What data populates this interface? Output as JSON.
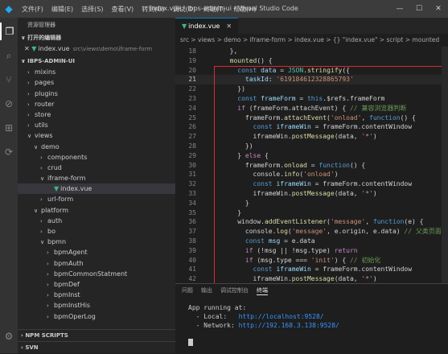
{
  "titlebar": {
    "menu": [
      "文件(F)",
      "编辑(E)",
      "选择(S)",
      "查看(V)",
      "转到(G)",
      "调试(D)",
      "终端(T)",
      "帮助(H)"
    ],
    "title": "index.vue - ibps-admin-ui - Visual Studio Code"
  },
  "sidebar": {
    "title": "资源管理器",
    "open_editors_header": "打开的编辑器",
    "open_file": {
      "name": "index.vue",
      "path": "src\\views\\demo\\iframe-form"
    },
    "project_header": "IBPS-ADMIN-UI",
    "tree": [
      {
        "label": "mixins",
        "depth": 1,
        "chevron": ">"
      },
      {
        "label": "pages",
        "depth": 1,
        "chevron": ">"
      },
      {
        "label": "plugins",
        "depth": 1,
        "chevron": ">"
      },
      {
        "label": "router",
        "depth": 1,
        "chevron": ">"
      },
      {
        "label": "store",
        "depth": 1,
        "chevron": ">"
      },
      {
        "label": "utils",
        "depth": 1,
        "chevron": ">"
      },
      {
        "label": "views",
        "depth": 1,
        "chevron": "v"
      },
      {
        "label": "demo",
        "depth": 2,
        "chevron": "v"
      },
      {
        "label": "components",
        "depth": 3,
        "chevron": ">"
      },
      {
        "label": "crud",
        "depth": 3,
        "chevron": ">"
      },
      {
        "label": "iframe-form",
        "depth": 3,
        "chevron": "v"
      },
      {
        "label": "index.vue",
        "depth": 4,
        "chevron": "",
        "vue": true,
        "selected": true
      },
      {
        "label": "url-form",
        "depth": 3,
        "chevron": ">"
      },
      {
        "label": "platform",
        "depth": 2,
        "chevron": "v"
      },
      {
        "label": "auth",
        "depth": 3,
        "chevron": ">"
      },
      {
        "label": "bo",
        "depth": 3,
        "chevron": ">"
      },
      {
        "label": "bpmn",
        "depth": 3,
        "chevron": "v"
      },
      {
        "label": "bpmAgent",
        "depth": 4,
        "chevron": ">"
      },
      {
        "label": "bpmAuth",
        "depth": 4,
        "chevron": ">"
      },
      {
        "label": "bpmCommonStatment",
        "depth": 4,
        "chevron": ">"
      },
      {
        "label": "bpmDef",
        "depth": 4,
        "chevron": ">"
      },
      {
        "label": "bpmInst",
        "depth": 4,
        "chevron": ">"
      },
      {
        "label": "bpmInstHis",
        "depth": 4,
        "chevron": ">"
      },
      {
        "label": "bpmOperLog",
        "depth": 4,
        "chevron": ">"
      }
    ],
    "npm_scripts": "NPM SCRIPTS",
    "svn": "SVN"
  },
  "editor": {
    "tab_label": "index.vue",
    "breadcrumb": "src > views > demo > iframe-form > index.vue > {} \"index.vue\" > script > mounted",
    "lines": [
      {
        "n": "18",
        "code": [
          [
            "c-plain",
            "  },"
          ]
        ]
      },
      {
        "n": "19",
        "code": [
          [
            "c-fn",
            "  mounted"
          ],
          [
            "c-plain",
            "() {"
          ]
        ]
      },
      {
        "n": "20",
        "code": [
          [
            "c-plain",
            "    "
          ],
          [
            "c-kw",
            "const "
          ],
          [
            "c-var",
            "data"
          ],
          [
            "c-plain",
            " = "
          ],
          [
            "c-cls",
            "JSON"
          ],
          [
            "c-plain",
            "."
          ],
          [
            "c-fn",
            "stringify"
          ],
          [
            "c-plain",
            "({"
          ]
        ]
      },
      {
        "n": "21",
        "code": [
          [
            "c-plain",
            "      "
          ],
          [
            "c-var",
            "taskId"
          ],
          [
            "c-plain",
            ": "
          ],
          [
            "c-str",
            "'619184612328865793'"
          ]
        ],
        "current": true
      },
      {
        "n": "22",
        "code": [
          [
            "c-plain",
            "    })"
          ]
        ]
      },
      {
        "n": "23",
        "code": [
          [
            "c-plain",
            "    "
          ],
          [
            "c-kw",
            "const "
          ],
          [
            "c-var",
            "frameForm"
          ],
          [
            "c-plain",
            " = "
          ],
          [
            "c-kw",
            "this"
          ],
          [
            "c-plain",
            ".$refs.frameForm"
          ]
        ]
      },
      {
        "n": "24",
        "code": [
          [
            "c-plain",
            "    "
          ],
          [
            "c-ctl",
            "if"
          ],
          [
            "c-plain",
            " (frameForm.attachEvent) { "
          ],
          [
            "c-cmt",
            "// 兼容浏览器判断"
          ]
        ]
      },
      {
        "n": "25",
        "code": [
          [
            "c-plain",
            "      frameForm."
          ],
          [
            "c-fn",
            "attachEvent"
          ],
          [
            "c-plain",
            "("
          ],
          [
            "c-str",
            "'onload'"
          ],
          [
            "c-plain",
            ", "
          ],
          [
            "c-kw",
            "function"
          ],
          [
            "c-plain",
            "() {"
          ]
        ]
      },
      {
        "n": "26",
        "code": [
          [
            "c-plain",
            "        "
          ],
          [
            "c-kw",
            "const "
          ],
          [
            "c-var",
            "iframeWin"
          ],
          [
            "c-plain",
            " = frameForm.contentWindow"
          ]
        ]
      },
      {
        "n": "27",
        "code": [
          [
            "c-plain",
            "        iframeWin."
          ],
          [
            "c-fn",
            "postMessage"
          ],
          [
            "c-plain",
            "(data, "
          ],
          [
            "c-str",
            "'*'"
          ],
          [
            "c-plain",
            ")"
          ]
        ]
      },
      {
        "n": "28",
        "code": [
          [
            "c-plain",
            "      })"
          ]
        ]
      },
      {
        "n": "29",
        "code": [
          [
            "c-plain",
            "    } "
          ],
          [
            "c-ctl",
            "else"
          ],
          [
            "c-plain",
            " {"
          ]
        ]
      },
      {
        "n": "30",
        "code": [
          [
            "c-plain",
            "      frameForm."
          ],
          [
            "c-fn",
            "onload"
          ],
          [
            "c-plain",
            " = "
          ],
          [
            "c-kw",
            "function"
          ],
          [
            "c-plain",
            "() {"
          ]
        ]
      },
      {
        "n": "31",
        "code": [
          [
            "c-plain",
            "        console."
          ],
          [
            "c-fn",
            "info"
          ],
          [
            "c-plain",
            "("
          ],
          [
            "c-str",
            "'onload'"
          ],
          [
            "c-plain",
            ")"
          ]
        ]
      },
      {
        "n": "32",
        "code": [
          [
            "c-plain",
            "        "
          ],
          [
            "c-kw",
            "const "
          ],
          [
            "c-var",
            "iframeWin"
          ],
          [
            "c-plain",
            " = frameForm.contentWindow"
          ]
        ]
      },
      {
        "n": "33",
        "code": [
          [
            "c-plain",
            "        iframeWin."
          ],
          [
            "c-fn",
            "postMessage"
          ],
          [
            "c-plain",
            "(data, "
          ],
          [
            "c-str",
            "'*'"
          ],
          [
            "c-plain",
            ")"
          ]
        ]
      },
      {
        "n": "34",
        "code": [
          [
            "c-plain",
            "      }"
          ]
        ]
      },
      {
        "n": "35",
        "code": [
          [
            "c-plain",
            "    }"
          ]
        ]
      },
      {
        "n": "36",
        "code": [
          [
            "c-plain",
            "    window."
          ],
          [
            "c-fn",
            "addEventListener"
          ],
          [
            "c-plain",
            "("
          ],
          [
            "c-str",
            "'message'"
          ],
          [
            "c-plain",
            ", "
          ],
          [
            "c-kw",
            "function"
          ],
          [
            "c-plain",
            "(e) {"
          ]
        ]
      },
      {
        "n": "37",
        "code": [
          [
            "c-plain",
            "      console."
          ],
          [
            "c-fn",
            "log"
          ],
          [
            "c-plain",
            "("
          ],
          [
            "c-str",
            "'message'"
          ],
          [
            "c-plain",
            ", e.origin, e.data) "
          ],
          [
            "c-cmt",
            "// 父类页面接收参数"
          ]
        ]
      },
      {
        "n": "38",
        "code": [
          [
            "c-plain",
            "      "
          ],
          [
            "c-kw",
            "const "
          ],
          [
            "c-var",
            "msg"
          ],
          [
            "c-plain",
            " = e.data"
          ]
        ]
      },
      {
        "n": "39",
        "code": [
          [
            "c-plain",
            "      "
          ],
          [
            "c-ctl",
            "if"
          ],
          [
            "c-plain",
            " (!msg || !msg.type) "
          ],
          [
            "c-ctl",
            "return"
          ]
        ]
      },
      {
        "n": "40",
        "code": [
          [
            "c-plain",
            "      "
          ],
          [
            "c-ctl",
            "if"
          ],
          [
            "c-plain",
            " (msg.type === "
          ],
          [
            "c-str",
            "'init'"
          ],
          [
            "c-plain",
            ") { "
          ],
          [
            "c-cmt",
            "// 初始化"
          ]
        ]
      },
      {
        "n": "41",
        "code": [
          [
            "c-plain",
            "        "
          ],
          [
            "c-kw",
            "const "
          ],
          [
            "c-var",
            "iframeWin"
          ],
          [
            "c-plain",
            " = frameForm.contentWindow"
          ]
        ]
      },
      {
        "n": "42",
        "code": [
          [
            "c-plain",
            "        iframeWin."
          ],
          [
            "c-fn",
            "postMessage"
          ],
          [
            "c-plain",
            "(data, "
          ],
          [
            "c-str",
            "'*'"
          ],
          [
            "c-plain",
            ")"
          ]
        ]
      }
    ]
  },
  "panel": {
    "tabs": [
      "问题",
      "输出",
      "调试控制台",
      "终端"
    ],
    "active_tab": "终端",
    "terminal": {
      "line1": "App running at:",
      "local_label": "  - Local:   ",
      "local_url": "http://localhost:9528/",
      "network_label": "  - Network: ",
      "network_url": "http://192.168.3.138:9528/"
    }
  }
}
